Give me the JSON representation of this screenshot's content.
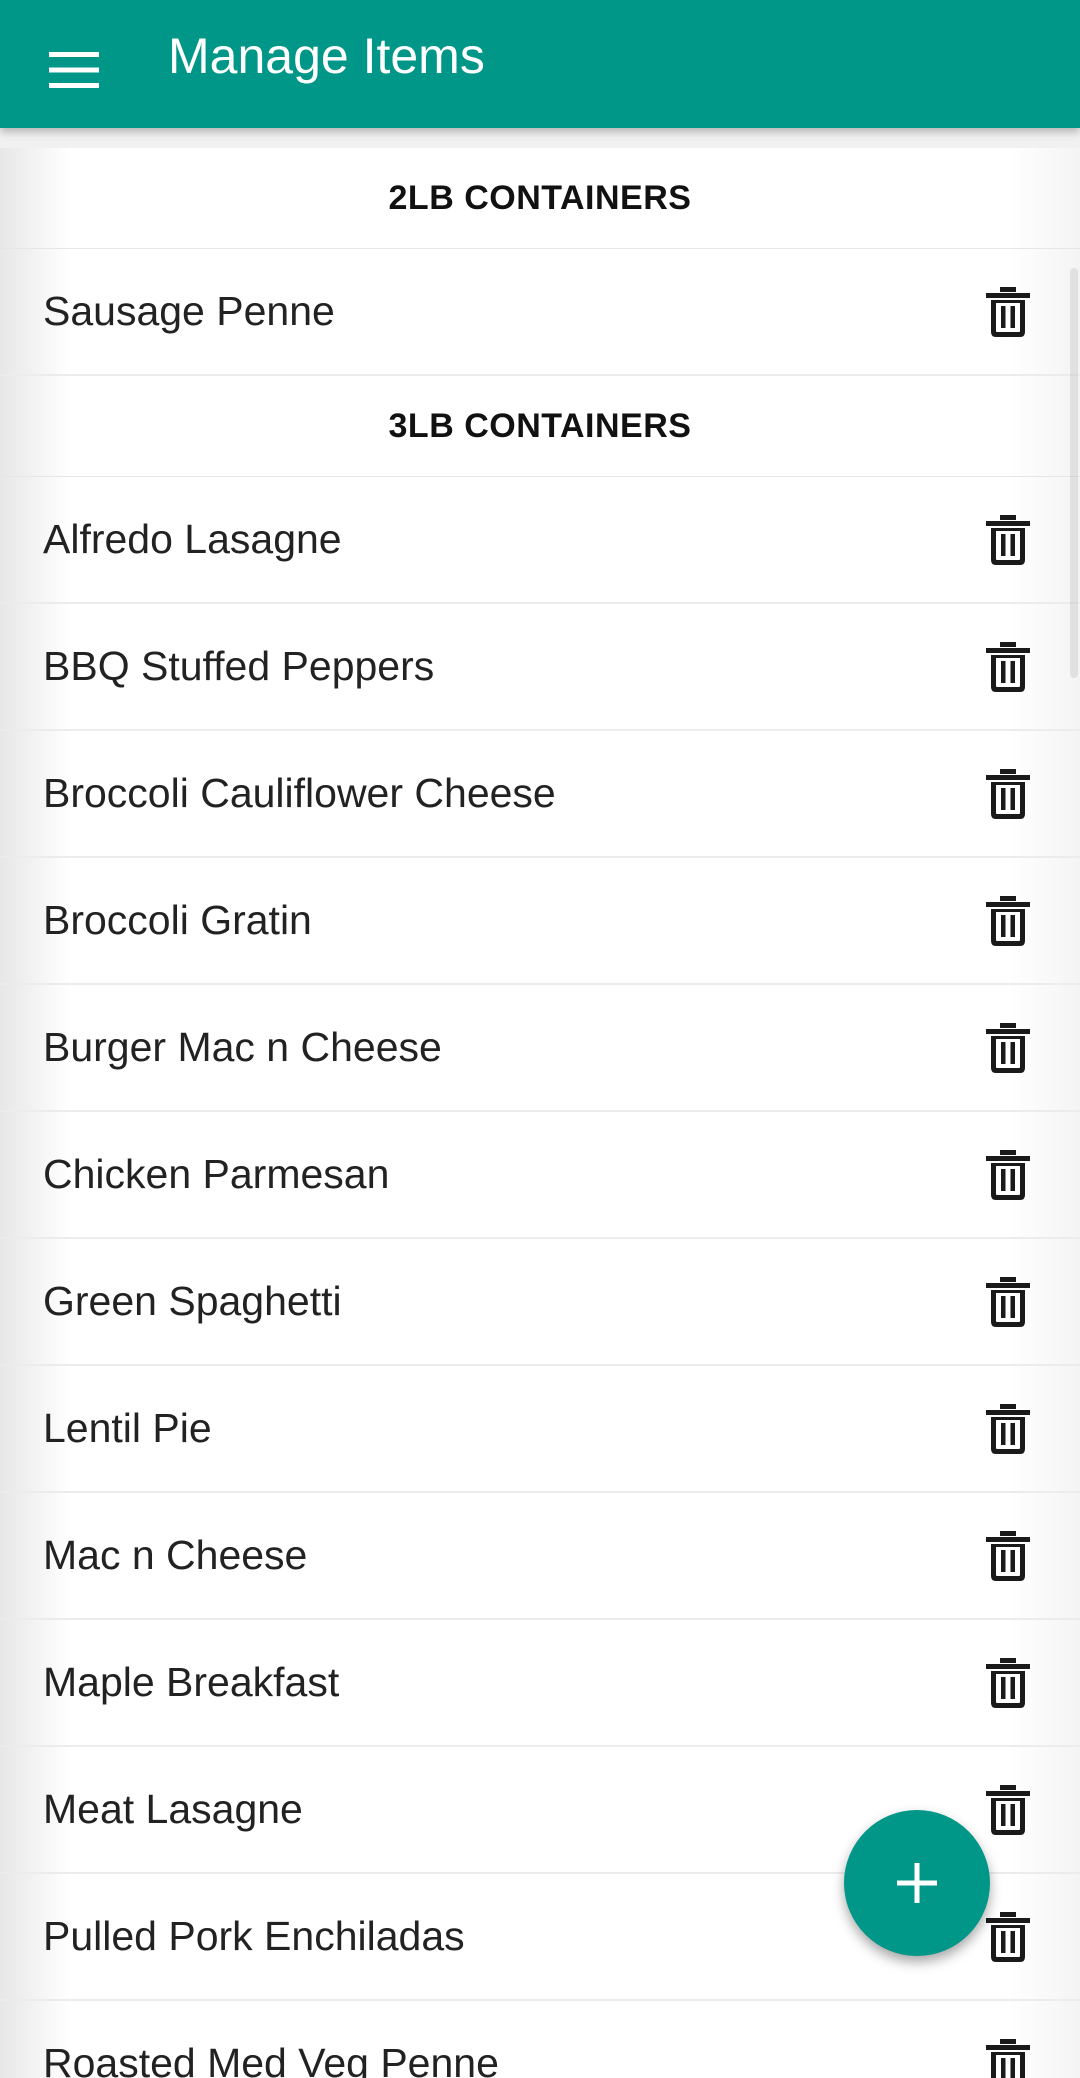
{
  "app_bar": {
    "title": "Manage Items",
    "menu_icon": "hamburger-menu-icon",
    "color": "#009688"
  },
  "sections": [
    {
      "header": "2LB CONTAINERS",
      "items": [
        "Sausage Penne"
      ]
    },
    {
      "header": "3LB CONTAINERS",
      "items": [
        "Alfredo Lasagne",
        "BBQ Stuffed Peppers",
        "Broccoli Cauliflower Cheese",
        "Broccoli Gratin",
        "Burger Mac n Cheese",
        "Chicken Parmesan",
        "Green Spaghetti",
        "Lentil Pie",
        "Mac n Cheese",
        "Maple Breakfast",
        "Meat Lasagne",
        "Pulled Pork Enchiladas",
        "Roasted Med Veg Penne"
      ]
    }
  ],
  "row_action_icon": "trash-icon",
  "fab": {
    "icon": "plus-icon",
    "color": "#009688"
  }
}
